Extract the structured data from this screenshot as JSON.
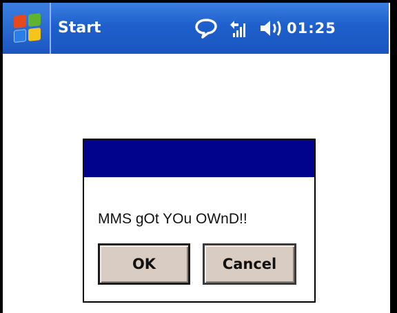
{
  "taskbar": {
    "title": "Start",
    "clock": "01:25",
    "icons": [
      "windows-logo-icon",
      "message-bubble-icon",
      "signal-icon",
      "speaker-icon"
    ]
  },
  "dialog": {
    "message": "MMS gOt YOu OWnD!!",
    "ok_label": "OK",
    "cancel_label": "Cancel"
  },
  "colors": {
    "taskbar_blue": "#1e5fcc",
    "dialog_caption": "#02038c",
    "button_face": "#d8ccc3"
  }
}
